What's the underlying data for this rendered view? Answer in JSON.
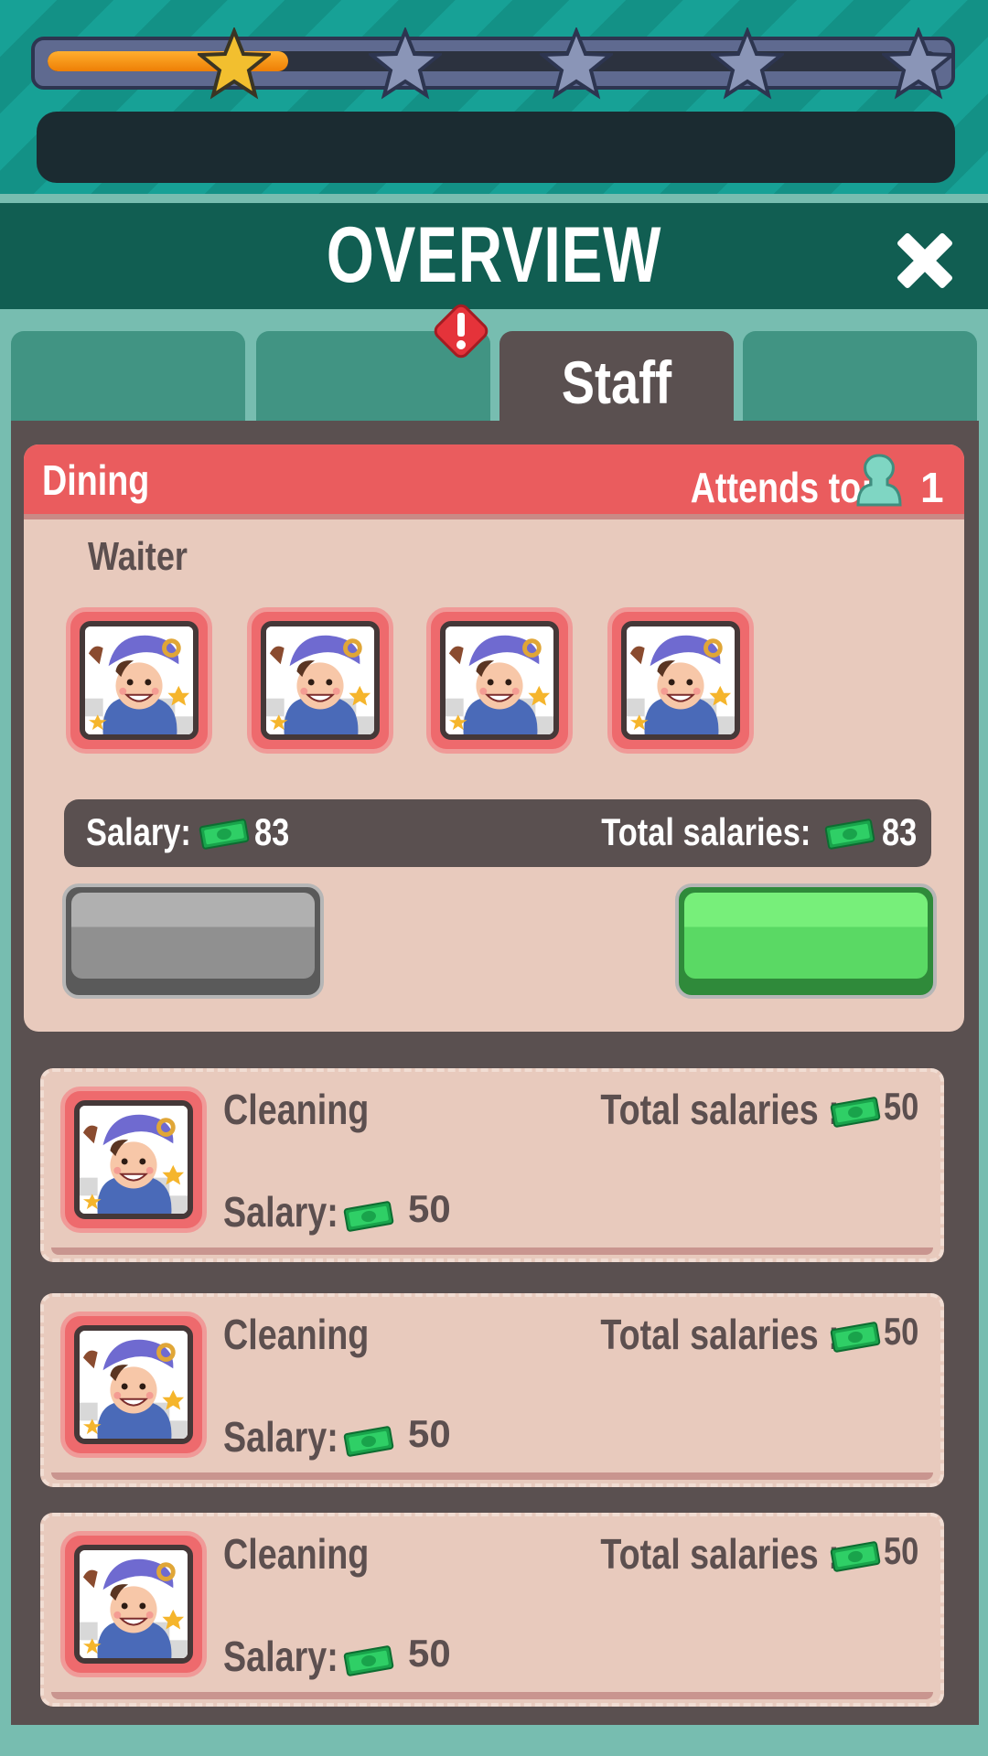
{
  "progress": {
    "fraction": 0.27,
    "stars_total": 5,
    "stars_earned": 1
  },
  "header": {
    "title": "OVERVIEW"
  },
  "tabs": [
    {
      "label": ""
    },
    {
      "label": ""
    },
    {
      "label": "Staff",
      "active": true
    },
    {
      "label": ""
    }
  ],
  "dining": {
    "title": "Dining",
    "attends_label": "Attends to:",
    "attends_count": "1",
    "role": "Waiter",
    "salary_label": "Salary:",
    "salary_value": "83",
    "total_label": "Total salaries:",
    "total_value": "83",
    "staff_count": 4
  },
  "staff_rows": [
    {
      "role": "Cleaning",
      "total_label": "Total salaries :",
      "total_value": "50",
      "salary_label": "Salary:",
      "salary_value": "50"
    },
    {
      "role": "Cleaning",
      "total_label": "Total salaries :",
      "total_value": "50",
      "salary_label": "Salary:",
      "salary_value": "50"
    },
    {
      "role": "Cleaning",
      "total_label": "Total salaries :",
      "total_value": "50",
      "salary_label": "Salary:",
      "salary_value": "50"
    }
  ],
  "colors": {
    "accent_red": "#ea5c5e",
    "panel_dark": "#5a5050",
    "card_bg": "#e8cabd",
    "header_teal": "#115e52",
    "button_green": "#5ad964"
  },
  "icons": [
    "star-icon",
    "close-icon",
    "alert-icon",
    "person-icon",
    "cash-icon",
    "chef-portrait"
  ]
}
